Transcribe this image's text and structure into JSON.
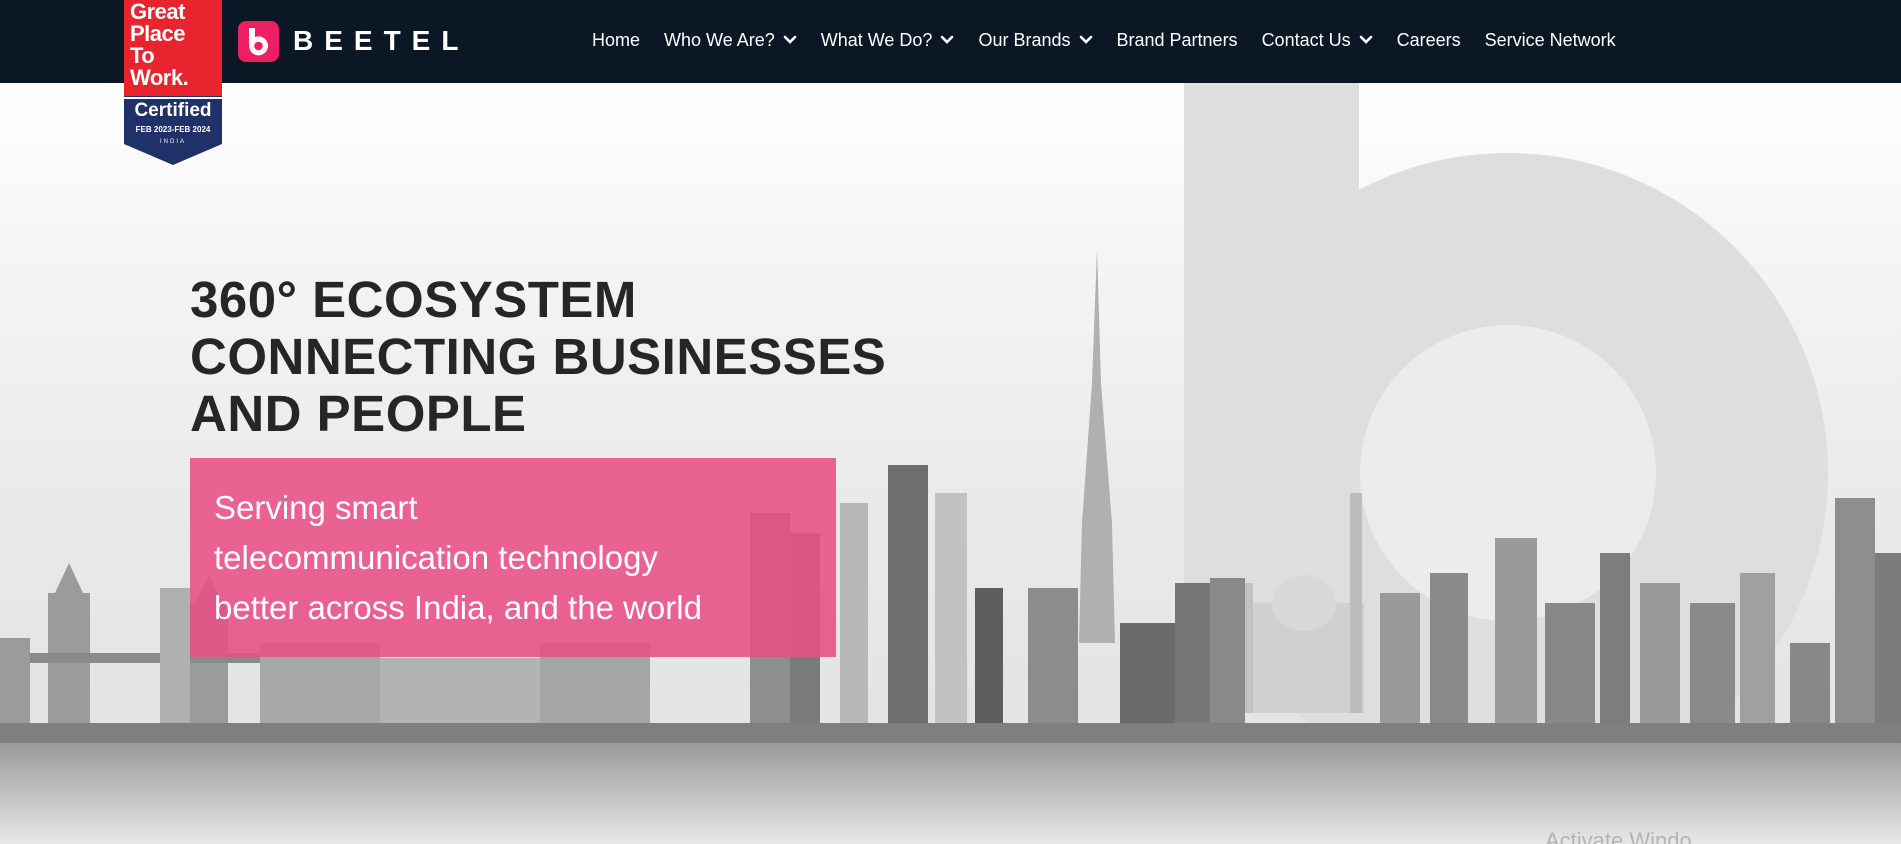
{
  "badge": {
    "lines": [
      "Great",
      "Place",
      "To",
      "Work."
    ],
    "certified": "Certified",
    "dates": "FEB 2023-FEB 2024",
    "country": "INDIA",
    "colors": {
      "red": "#e8242f",
      "navy": "#1f3168"
    }
  },
  "brand": {
    "name": "BEETEL",
    "logo_icon": "beetel-b-logo-icon",
    "accent": "#ec1f63"
  },
  "nav": {
    "items": [
      {
        "label": "Home",
        "dropdown": false
      },
      {
        "label": "Who We Are?",
        "dropdown": true
      },
      {
        "label": "What We Do?",
        "dropdown": true
      },
      {
        "label": "Our Brands",
        "dropdown": true
      },
      {
        "label": "Brand Partners",
        "dropdown": false
      },
      {
        "label": "Contact Us",
        "dropdown": true
      },
      {
        "label": "Careers",
        "dropdown": false
      },
      {
        "label": "Service Network",
        "dropdown": false
      }
    ],
    "dropdown_icon": "chevron-down-icon"
  },
  "hero": {
    "headline": [
      "360° ECOSYSTEM",
      "CONNECTING BUSINESSES",
      "AND PEOPLE"
    ],
    "tagline": [
      "Serving smart",
      "telecommunication technology",
      "better across India, and the world"
    ],
    "tagline_bg": "#e84e85",
    "watermark": "Activate Windo"
  },
  "colors": {
    "header_bg": "#0b1724",
    "headline": "#262626"
  }
}
